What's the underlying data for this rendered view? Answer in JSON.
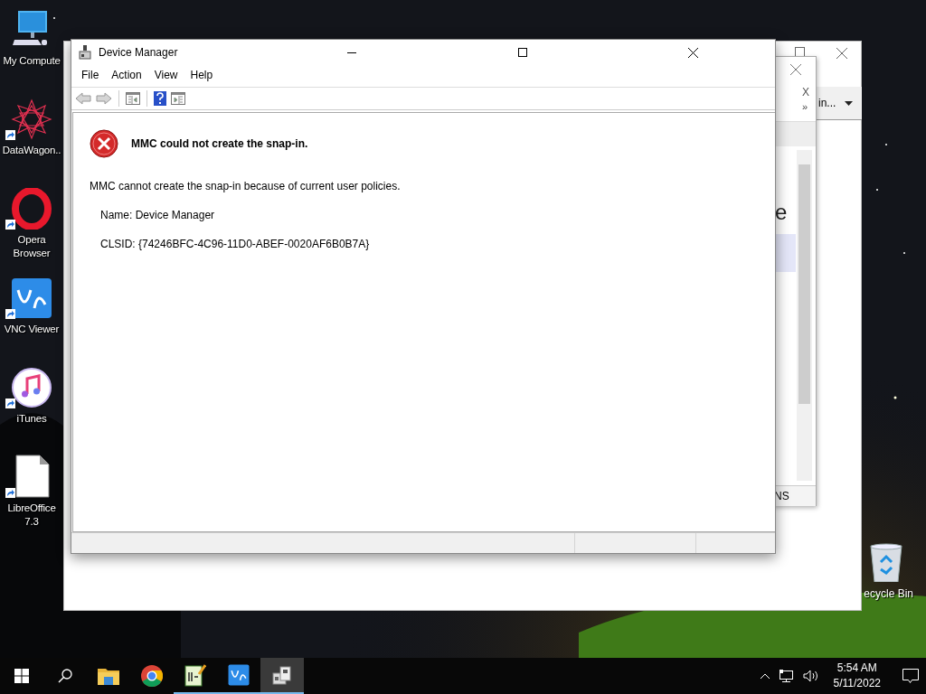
{
  "desktop_icons": [
    {
      "label": "My Compute",
      "kind": "computer",
      "shortcut": false
    },
    {
      "label": "DataWagon..",
      "kind": "star",
      "shortcut": true
    },
    {
      "label": "Opera Browser",
      "kind": "ring",
      "shortcut": true
    },
    {
      "label": "VNC Viewer",
      "kind": "tile",
      "shortcut": true
    },
    {
      "label": "iTunes",
      "kind": "music",
      "shortcut": true
    },
    {
      "label": "LibreOffice 7.3",
      "kind": "document",
      "shortcut": true
    }
  ],
  "recycle_bin": {
    "label": "ecycle Bin"
  },
  "back_window": {
    "toolbar_text": "in..."
  },
  "middle_window": {
    "close_text": "X",
    "overflow": "»",
    "heading_fragment": "e",
    "status_fragment": "NS"
  },
  "window": {
    "title": "Device Manager",
    "menu": [
      "File",
      "Action",
      "View",
      "Help"
    ],
    "toolbar": [
      {
        "kind": "back",
        "disabled": true
      },
      {
        "kind": "forward",
        "disabled": true
      },
      {
        "kind": "separator"
      },
      {
        "kind": "tree-pane",
        "disabled": false
      },
      {
        "kind": "separator"
      },
      {
        "kind": "help",
        "disabled": false
      },
      {
        "kind": "action-pane",
        "disabled": false
      }
    ],
    "error": {
      "heading": "MMC could not create the snap-in.",
      "message": "MMC cannot create the snap-in because of current user policies.",
      "details": [
        "Name: Device Manager",
        "CLSID: {74246BFC-4C96-11D0-ABEF-0020AF6B0B7A}"
      ]
    }
  },
  "taskbar": {
    "apps": [
      {
        "kind": "folder",
        "running": false,
        "selected": false
      },
      {
        "kind": "chrome",
        "running": false,
        "selected": false
      },
      {
        "kind": "editor",
        "running": true,
        "selected": false
      },
      {
        "kind": "tile",
        "running": true,
        "selected": false
      },
      {
        "kind": "device",
        "running": true,
        "selected": true
      }
    ],
    "time": "5:54 AM",
    "date": "5/11/2022"
  }
}
